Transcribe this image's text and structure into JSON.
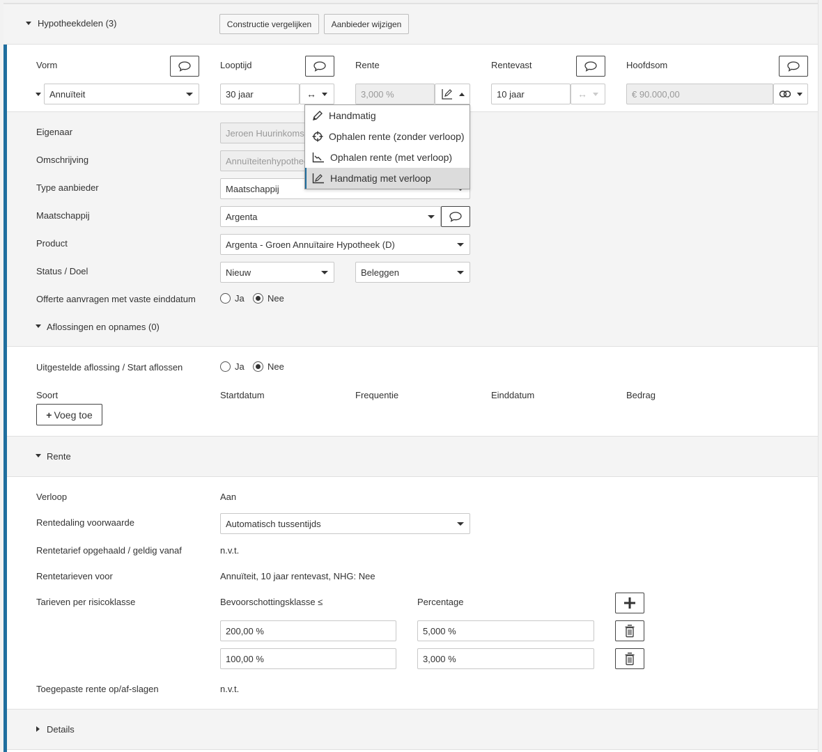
{
  "section": {
    "title": "Hypotheekdelen (3)",
    "compare_button": "Constructie vergelijken",
    "provider_button": "Aanbieder wijzigen"
  },
  "columns": {
    "vorm": "Vorm",
    "looptijd": "Looptijd",
    "rente": "Rente",
    "rentevast": "Rentevast",
    "hoofdsom": "Hoofdsom"
  },
  "row": {
    "vorm_value": "Annuïteit",
    "looptijd_value": "30 jaar",
    "rente_value": "3,000 %",
    "rentevast_value": "10 jaar",
    "hoofdsom_value": "€ 90.000,00"
  },
  "rente_menu": {
    "items": [
      {
        "label": "Handmatig",
        "icon": "pencil-icon"
      },
      {
        "label": "Ophalen rente (zonder verloop)",
        "icon": "crosshair-icon"
      },
      {
        "label": "Ophalen rente (met verloop)",
        "icon": "chart-line-icon"
      },
      {
        "label": "Handmatig met verloop",
        "icon": "pencil-chart-icon"
      }
    ],
    "active_index": 3
  },
  "details": {
    "eigenaar_label": "Eigenaar",
    "eigenaar_value": "Jeroen Huurinkoms",
    "omschrijving_label": "Omschrijving",
    "omschrijving_value": "Annuïteitenhypothee",
    "type_label": "Type aanbieder",
    "type_value": "Maatschappij",
    "maatschappij_label": "Maatschappij",
    "maatschappij_value": "Argenta",
    "product_label": "Product",
    "product_value": "Argenta - Groen Annuïtaire Hypotheek (D)",
    "status_label": "Status / Doel",
    "status_value": "Nieuw",
    "doel_value": "Beleggen",
    "offerte_label": "Offerte aanvragen met vaste einddatum",
    "ja": "Ja",
    "nee": "Nee",
    "aflossingen_toggle": "Aflossingen en opnames (0)"
  },
  "aflossing": {
    "uitgestelde_label": "Uitgestelde aflossing / Start aflossen",
    "ja": "Ja",
    "nee": "Nee",
    "headers": [
      "Soort",
      "Startdatum",
      "Frequentie",
      "Einddatum",
      "Bedrag"
    ],
    "add_button": "Voeg toe"
  },
  "rente": {
    "toggle": "Rente",
    "verloop_label": "Verloop",
    "verloop_value": "Aan",
    "rentedaling_label": "Rentedaling voorwaarde",
    "rentedaling_value": "Automatisch tussentijds",
    "opgehaald_label": "Rentetarief opgehaald / geldig vanaf",
    "opgehaald_value": "n.v.t.",
    "tarieven_voor_label": "Rentetarieven voor",
    "tarieven_voor_value": "Annuïteit, 10 jaar rentevast, NHG: Nee",
    "risicoklasse_label": "Tarieven per risicoklasse",
    "klasse_header": "Bevoorschottingsklasse ≤",
    "percentage_header": "Percentage",
    "rows": [
      {
        "klasse": "200,00 %",
        "percentage": "5,000 %"
      },
      {
        "klasse": "100,00 %",
        "percentage": "3,000 %"
      }
    ],
    "toegepast_label": "Toegepaste rente op/af-slagen",
    "toegepast_value": "n.v.t."
  },
  "details_toggle": "Details"
}
